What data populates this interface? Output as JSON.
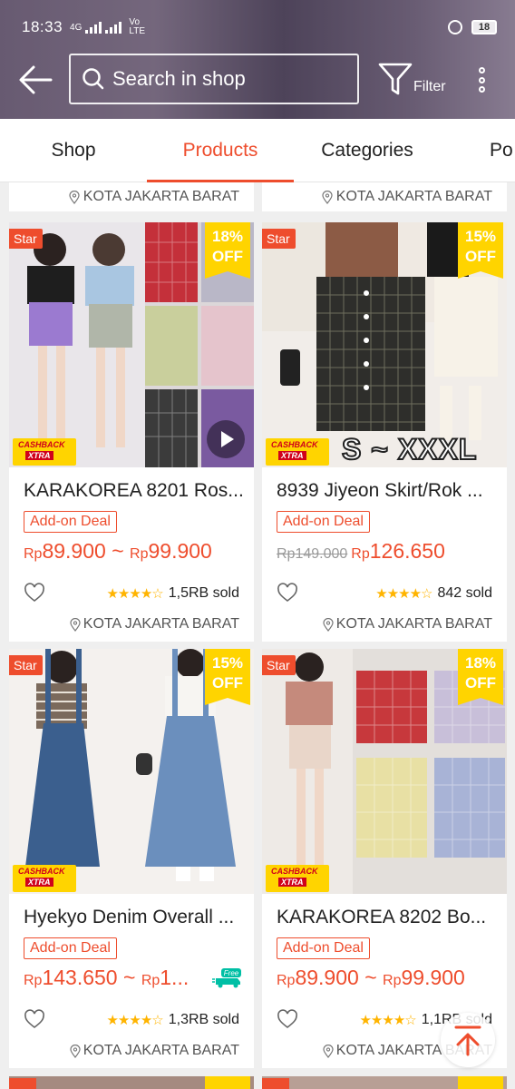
{
  "status_bar": {
    "time": "18:33",
    "network": "4G",
    "carrier": "Vo LTE",
    "battery": "18"
  },
  "header": {
    "search_placeholder": "Search in shop",
    "filter_label": "Filter"
  },
  "tabs": [
    {
      "label": "Shop",
      "active": false
    },
    {
      "label": "Products",
      "active": true
    },
    {
      "label": "Categories",
      "active": false
    },
    {
      "label": "Po",
      "active": false
    }
  ],
  "top_locations": [
    "KOTA JAKARTA BARAT",
    "KOTA JAKARTA BARAT"
  ],
  "products": [
    {
      "title": "KARAKOREA 8201 Ros...",
      "star": "Star",
      "discount": "18%",
      "discount_off": "OFF",
      "cashback": "CASHBACK",
      "cashback_xtra": "XTRA",
      "deal": "Add-on Deal",
      "price_currency": "Rp",
      "price": "89.900",
      "price_sep": "~",
      "price_currency_2": "Rp",
      "price_2": "99.900",
      "old_price": "",
      "sold": "1,5RB sold",
      "rating": 4.5,
      "location": "KOTA JAKARTA BARAT",
      "has_video": true,
      "free_shipping": false
    },
    {
      "title": "8939 Jiyeon Skirt/Rok ...",
      "star": "Star",
      "discount": "15%",
      "discount_off": "OFF",
      "cashback": "CASHBACK",
      "cashback_xtra": "XTRA",
      "image_text": "S ~ XXXL",
      "deal": "Add-on Deal",
      "old_price": "Rp149.000",
      "price_currency": "Rp",
      "price": "126.650",
      "sold": "842 sold",
      "rating": 4.5,
      "location": "KOTA JAKARTA BARAT",
      "has_video": false,
      "free_shipping": false
    },
    {
      "title": "Hyekyo Denim Overall ...",
      "star": "Star",
      "discount": "15%",
      "discount_off": "OFF",
      "cashback": "CASHBACK",
      "cashback_xtra": "XTRA",
      "deal": "Add-on Deal",
      "price_currency": "Rp",
      "price": "143.650",
      "price_sep": "~",
      "price_currency_2": "Rp",
      "price_2": "1...",
      "free_label": "Free",
      "sold": "1,3RB sold",
      "rating": 4.5,
      "location": "KOTA JAKARTA BARAT",
      "has_video": false,
      "free_shipping": true
    },
    {
      "title": "KARAKOREA 8202 Bo...",
      "star": "Star",
      "discount": "18%",
      "discount_off": "OFF",
      "cashback": "CASHBACK",
      "cashback_xtra": "XTRA",
      "deal": "Add-on Deal",
      "price_currency": "Rp",
      "price": "89.900",
      "price_sep": "~",
      "price_currency_2": "Rp",
      "price_2": "99.900",
      "sold": "1,1RB sold",
      "rating": 4.5,
      "location": "KOTA JAKARTA BARAT",
      "has_video": false,
      "free_shipping": false
    }
  ],
  "colors": {
    "accent": "#ee4d2d",
    "badge_yellow": "#ffd400",
    "star": "#ffb400"
  },
  "icons": [
    "back-arrow-icon",
    "search-icon",
    "filter-icon",
    "more-vertical-icon",
    "heart-icon",
    "location-pin-icon",
    "play-icon",
    "free-shipping-icon",
    "scroll-to-top-icon"
  ]
}
